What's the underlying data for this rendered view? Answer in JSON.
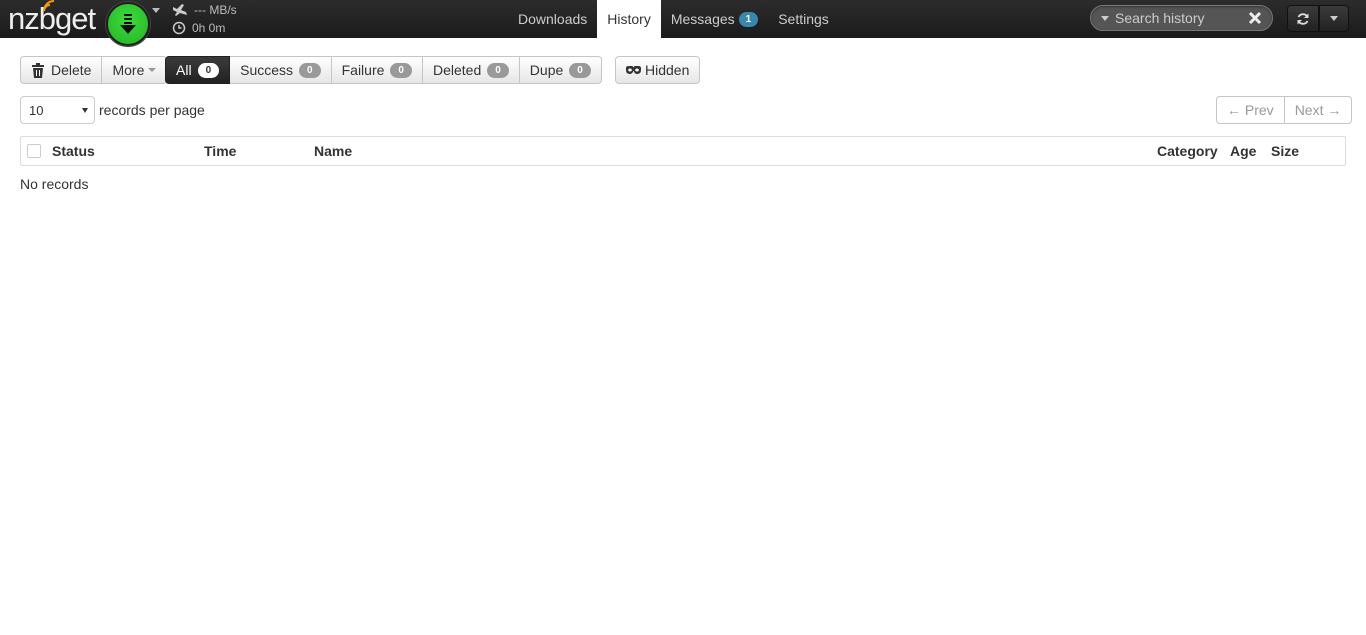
{
  "app": {
    "logo_prefix": "nz",
    "logo_b": "b",
    "logo_suffix": "get"
  },
  "status": {
    "speed": "--- MB/s",
    "time_left": "0h 0m"
  },
  "nav": {
    "tabs": [
      {
        "label": "Downloads"
      },
      {
        "label": "History",
        "active": true
      },
      {
        "label": "Messages",
        "badge": "1"
      },
      {
        "label": "Settings"
      }
    ]
  },
  "search": {
    "placeholder": "Search history"
  },
  "toolbar": {
    "delete_label": "Delete",
    "more_label": "More",
    "filters": [
      {
        "label": "All",
        "count": "0",
        "active": true
      },
      {
        "label": "Success",
        "count": "0"
      },
      {
        "label": "Failure",
        "count": "0"
      },
      {
        "label": "Deleted",
        "count": "0"
      },
      {
        "label": "Dupe",
        "count": "0"
      }
    ],
    "hidden_label": "Hidden"
  },
  "paging": {
    "per_page_value": "10",
    "per_page_label": "records per page",
    "prev_label": "← Prev",
    "next_label": "Next →"
  },
  "table": {
    "columns": [
      "Status",
      "Time",
      "Name",
      "Category",
      "Age",
      "Size"
    ],
    "empty_text": "No records"
  },
  "colors": {
    "play_green": "#2ecc2e",
    "badge_blue": "#3a87ad",
    "navbar": "#1b1b1b"
  }
}
